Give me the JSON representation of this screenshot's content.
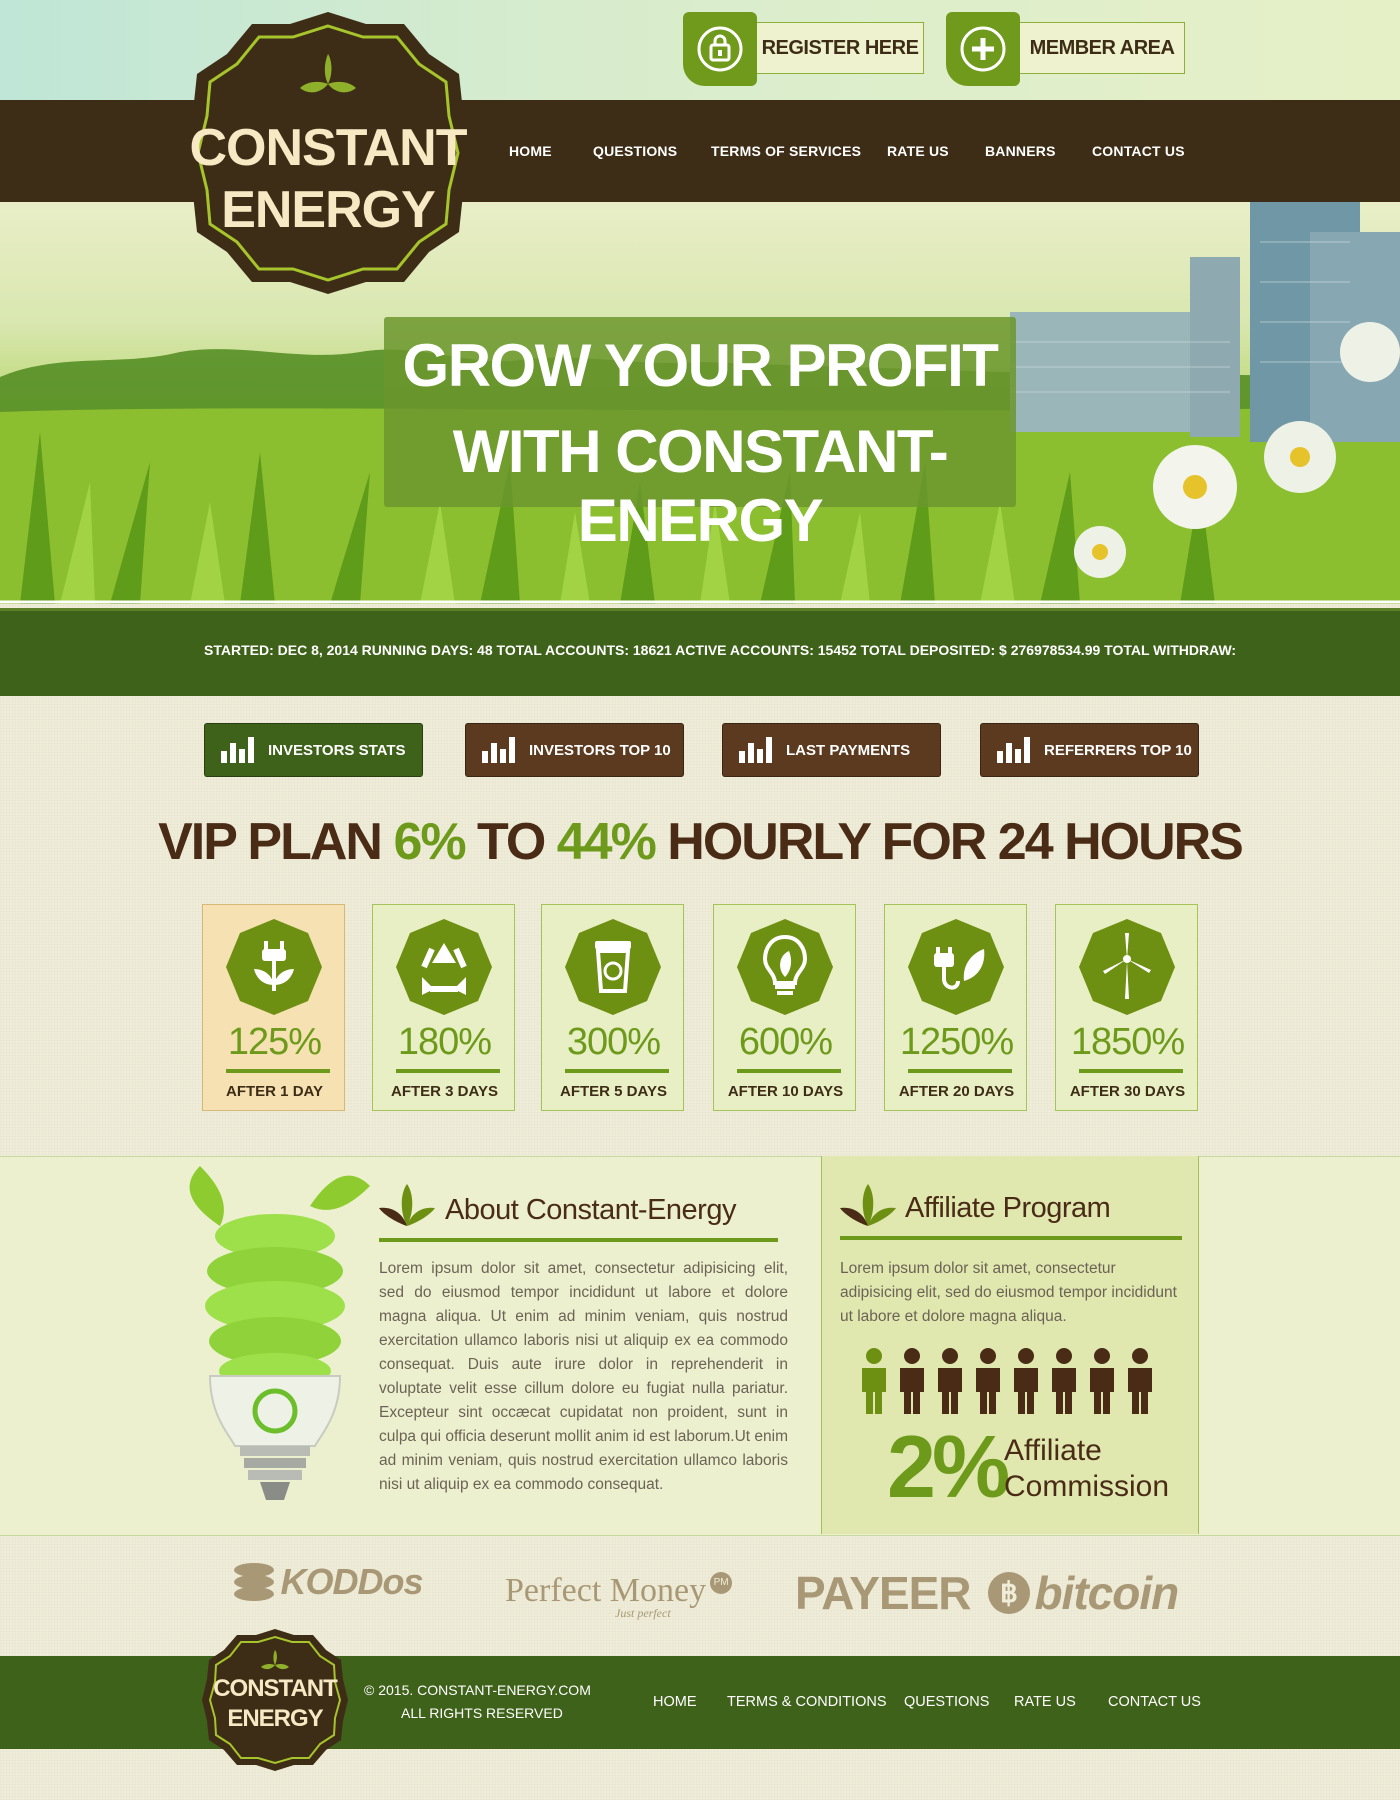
{
  "header": {
    "register_label": "REGISTER HERE",
    "member_label": "MEMBER AREA",
    "logo_line1": "CONSTANT",
    "logo_line2": "ENERGY",
    "nav": [
      "HOME",
      "QUESTIONS",
      "TERMS OF SERVICES",
      "RATE US",
      "BANNERS",
      "CONTACT US"
    ]
  },
  "hero": {
    "line1": "GROW YOUR PROFIT",
    "line2": "WITH CONSTANT-ENERGY"
  },
  "stats": {
    "text": "STARTED:  DEC 8, 2014 RUNNING DAYS:  48 TOTAL ACCOUNTS:  18621 ACTIVE ACCOUNTS:  15452 TOTAL DEPOSITED:  $ 276978534.99 TOTAL WITHDRAW:"
  },
  "tabs": [
    "INVESTORS STATS",
    "INVESTORS TOP 10",
    "LAST PAYMENTS",
    "REFERRERS TOP 10"
  ],
  "vip": {
    "t1": "VIP PLAN ",
    "t2": "6%",
    "t3": " TO ",
    "t4": "44%",
    "t5": " HOURLY FOR 24 HOURS"
  },
  "plans": [
    {
      "pct": "125%",
      "after": "AFTER 1 DAY",
      "icon": "plug-plant-icon"
    },
    {
      "pct": "180%",
      "after": "AFTER 3 DAYS",
      "icon": "recycle-icon"
    },
    {
      "pct": "300%",
      "after": "AFTER 5 DAYS",
      "icon": "recycle-bin-icon"
    },
    {
      "pct": "600%",
      "after": "AFTER 10 DAYS",
      "icon": "leaf-bulb-icon"
    },
    {
      "pct": "1250%",
      "after": "AFTER 20 DAYS",
      "icon": "eco-plug-icon"
    },
    {
      "pct": "1850%",
      "after": "AFTER 30 DAYS",
      "icon": "wind-turbine-icon"
    }
  ],
  "about": {
    "title": "About Constant-Energy",
    "text": "Lorem ipsum dolor sit amet, consectetur adipisicing elit, sed do eiusmod tempor incididunt ut labore et dolore magna aliqua. Ut enim ad minim veniam, quis nostrud exercitation ullamco laboris nisi ut aliquip ex ea commodo consequat. Duis aute irure dolor in reprehenderit in voluptate velit esse cillum dolore eu fugiat nulla pariatur. Excepteur sint occæcat cupidatat non proident, sunt in culpa qui officia deserunt mollit anim id est laborum.Ut enim ad minim veniam, quis nostrud exercitation ullamco laboris nisi ut aliquip ex ea commodo consequat."
  },
  "affiliate": {
    "title": "Affiliate Program",
    "text": "Lorem ipsum dolor sit amet, consectetur adipisicing elit, sed do eiusmod tempor incididunt ut labore et dolore magna aliqua.",
    "pct": "2%",
    "label1": "Affiliate",
    "label2": "Commission"
  },
  "payments": [
    "KODDos",
    "Perfect Money",
    "PAYEER",
    "bitcoin"
  ],
  "payment_extra": {
    "pm_tagline": "Just perfect",
    "pm_badge": "PM"
  },
  "footer": {
    "copyright": "© 2015. CONSTANT-ENERGY.COM",
    "rights": "ALL RIGHTS RESERVED",
    "links": [
      "HOME",
      "TERMS & CONDITIONS",
      "QUESTIONS",
      "RATE US",
      "CONTACT US"
    ]
  },
  "colors": {
    "brown": "#3e2d16",
    "green": "#6d9a1b",
    "dark_green": "#3f621b",
    "cream": "#efedd8"
  }
}
